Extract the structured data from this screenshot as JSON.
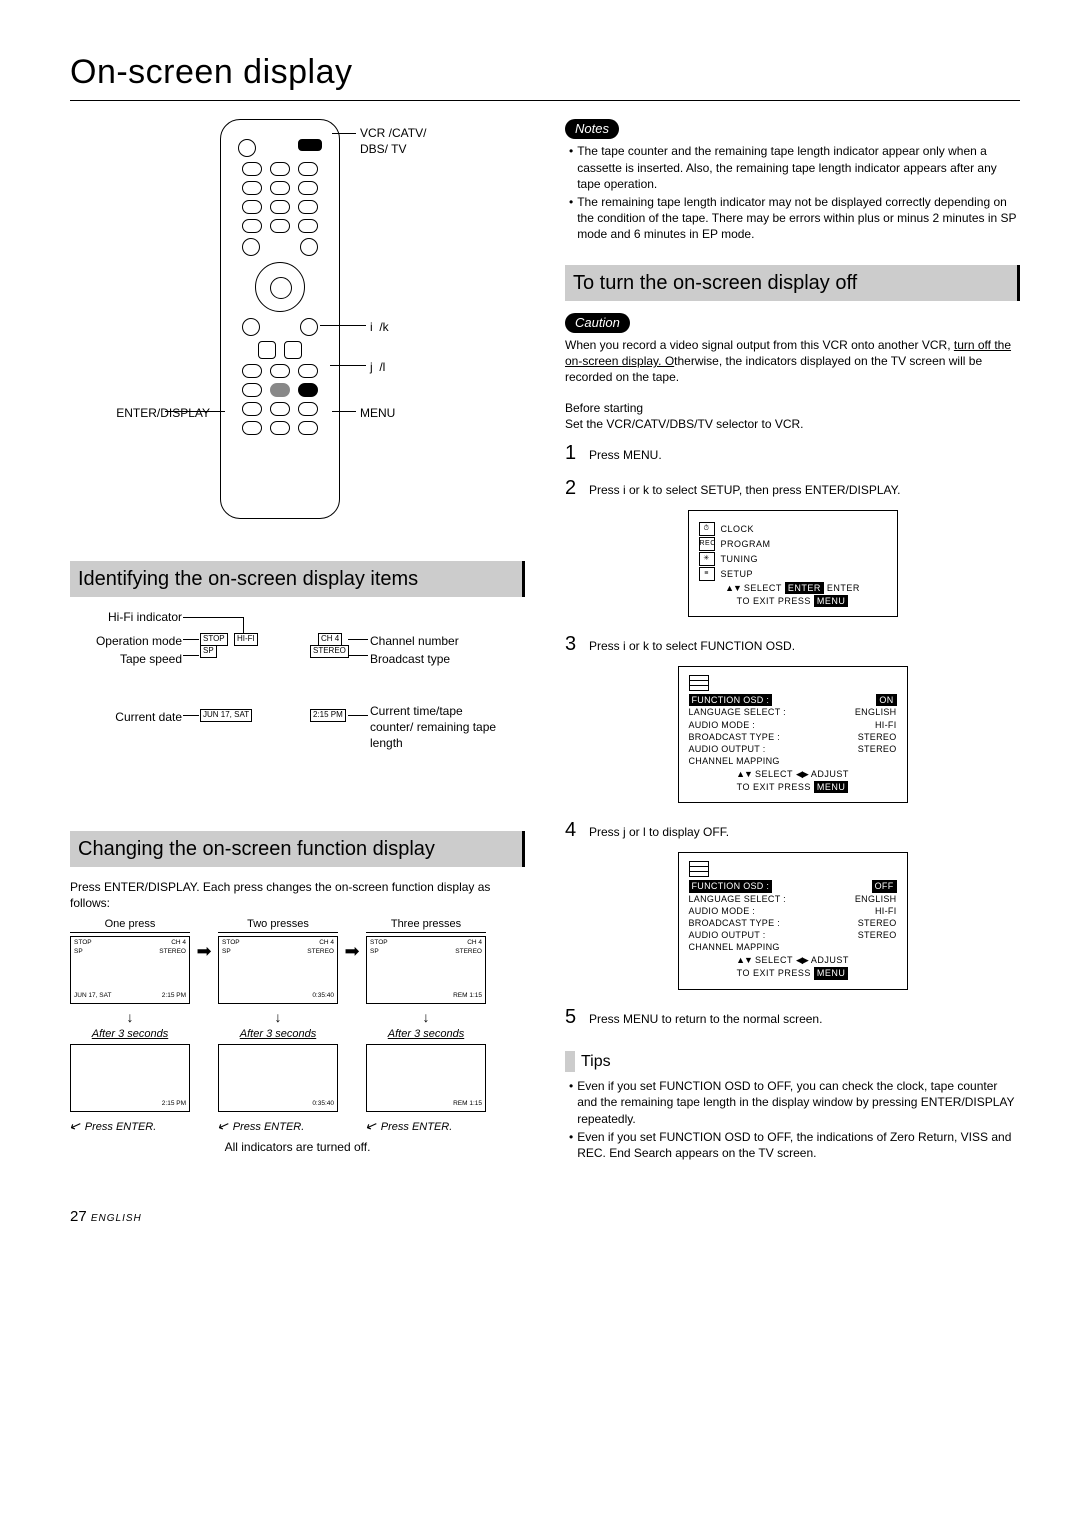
{
  "title": "On-screen display",
  "remote": {
    "selector_label": "VCR /CATV/\nDBS/ TV",
    "up_down": "i  /k",
    "left_right": "j  /l",
    "menu": "MENU",
    "enter": "ENTER/DISPLAY"
  },
  "identify": {
    "heading": "Identifying the on-screen display items",
    "labels_left": [
      "Hi-Fi indicator",
      "Operation mode",
      "Tape speed",
      "Current date"
    ],
    "labels_right": [
      "Channel number",
      "Broadcast type",
      "Current time/tape counter/ remaining tape length"
    ],
    "box_stop": "STOP",
    "box_hifi": "HI-FI",
    "box_sp": "SP",
    "box_ch": "CH  4",
    "box_stereo": "STEREO",
    "box_date": "JUN  17,  SAT",
    "box_time": "2:15  PM"
  },
  "changing": {
    "heading": "Changing the on-screen function display",
    "intro": "Press ENTER/DISPLAY. Each press changes the on-screen function display as follows:",
    "col_titles": [
      "One press",
      "Two presses",
      "Three presses"
    ],
    "after": "After 3 seconds",
    "press_enter": "Press ENTER.",
    "all_off": "All indicators are turned off.",
    "screens": {
      "top_stop": "STOP",
      "top_sp": "SP",
      "top_ch": "CH  4",
      "top_stereo": "STEREO",
      "date": "JUN  17,  SAT",
      "time": "2:15  PM",
      "counter": "0:35:40",
      "rem": "REM  1:15"
    }
  },
  "notes": {
    "title": "Notes",
    "items": [
      "The tape counter and the remaining tape length indicator appear only when a cassette is inserted. Also, the remaining tape length indicator appears after any tape operation.",
      "The remaining tape length indicator may not be displayed correctly depending on the condition of the tape. There may be errors within plus or minus 2 minutes in SP mode and 6 minutes in EP mode."
    ]
  },
  "turn_off": {
    "heading": "To turn the on-screen display off",
    "caution_title": "Caution",
    "caution_pre": "When you record a video signal output from this VCR onto another VCR,  ",
    "caution_u": "turn off the on-screen display. O",
    "caution_post": "therwise, the indicators displayed on the TV screen will be recorded on the tape.",
    "before": "Before starting",
    "before_text": "Set the VCR/CATV/DBS/TV selector to VCR.",
    "steps": [
      "Press MENU.",
      "Press  i   or  k   to select SETUP, then press ENTER/DISPLAY.",
      "Press  i   or  k   to select FUNCTION OSD.",
      "Press  j   or  l   to display OFF.",
      "Press MENU to return to the normal screen."
    ],
    "menu1": {
      "clock": "CLOCK",
      "program": "PROGRAM",
      "tuning": "TUNING",
      "setup": "SETUP",
      "sel": "SELECT",
      "enter": "ENTER",
      "enter2": "ENTER",
      "exit": "TO  EXIT  PRESS",
      "menu": "MENU"
    },
    "setup_on": {
      "title": "FUNCTION  OSD :",
      "title_val": "ON",
      "rows": [
        [
          "LANGUAGE  SELECT :",
          "ENGLISH"
        ],
        [
          "AUDIO  MODE :",
          "HI-FI"
        ],
        [
          "BROADCAST  TYPE :",
          "STEREO"
        ],
        [
          "AUDIO  OUTPUT :",
          "STEREO"
        ],
        [
          "CHANNEL  MAPPING",
          ""
        ]
      ],
      "sel": "SELECT",
      "adj": "ADJUST",
      "exit": "TO  EXIT  PRESS",
      "menu": "MENU"
    },
    "setup_off": {
      "title": "FUNCTION  OSD :",
      "title_val": "OFF",
      "rows": [
        [
          "LANGUAGE  SELECT :",
          "ENGLISH"
        ],
        [
          "AUDIO  MODE :",
          "HI-FI"
        ],
        [
          "BROADCAST  TYPE :",
          "STEREO"
        ],
        [
          "AUDIO  OUTPUT :",
          "STEREO"
        ],
        [
          "CHANNEL  MAPPING",
          ""
        ]
      ],
      "sel": "SELECT",
      "adj": "ADJUST",
      "exit": "TO  EXIT  PRESS",
      "menu": "MENU"
    }
  },
  "tips": {
    "title": "Tips",
    "items": [
      "Even if you set FUNCTION OSD to OFF, you can check the clock, tape counter and the remaining tape length in the display window by pressing ENTER/DISPLAY repeatedly.",
      "Even if you set FUNCTION OSD to OFF, the indications of Zero Return, VISS and REC. End Search appears on the TV screen."
    ]
  },
  "page": {
    "num": "27",
    "lang": "ENGLISH"
  }
}
